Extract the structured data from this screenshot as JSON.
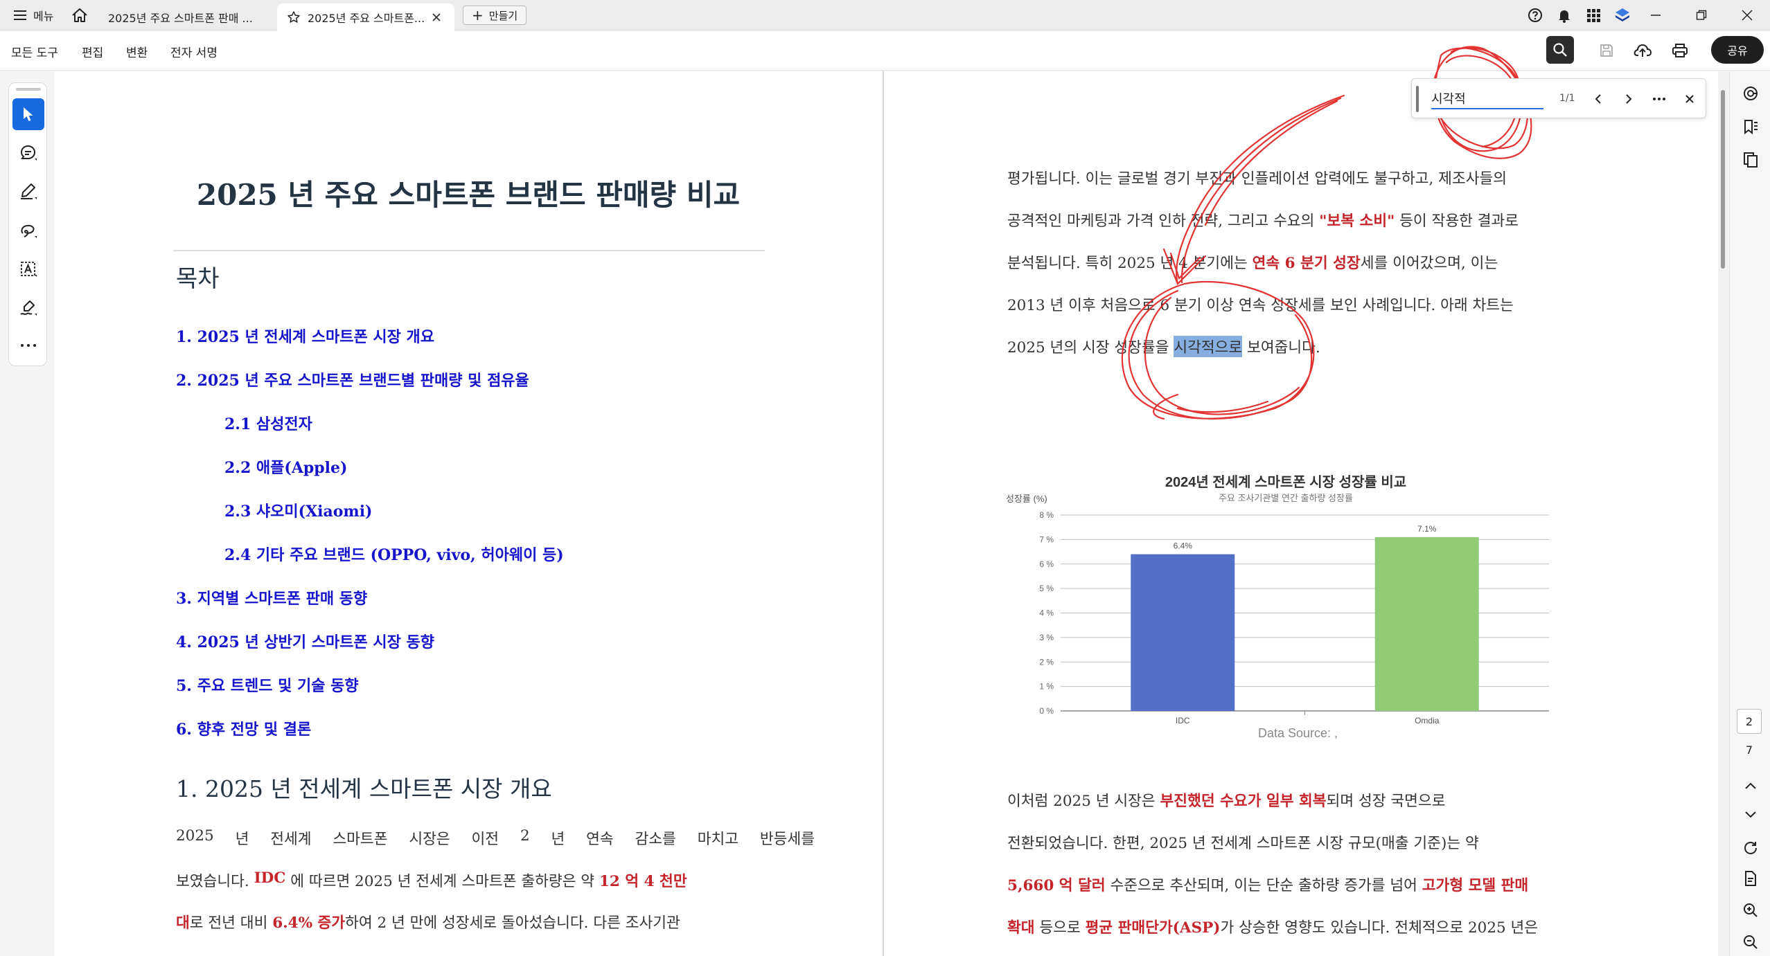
{
  "tabbar": {
    "menu_label": "메뉴",
    "tabs": [
      {
        "label": "2025년 주요 스마트폰 판매 ...",
        "active": false
      },
      {
        "label": "2025년 주요 스마트폰...",
        "active": true
      }
    ],
    "new_label": "만들기"
  },
  "toolbar": {
    "items": [
      "모든 도구",
      "편집",
      "변환",
      "전자 서명"
    ],
    "share_label": "공유"
  },
  "findbar": {
    "query": "시각적",
    "count": "1/1"
  },
  "left_page": {
    "title": "2025 년 주요 스마트폰 브랜드 판매량 비교",
    "toc_heading": "목차",
    "toc": [
      "1. 2025 년 전세계 스마트폰 시장 개요",
      "2. 2025 년 주요 스마트폰 브랜드별 판매량 및 점유율",
      "2.1 삼성전자",
      "2.2 애플(Apple)",
      "2.3 샤오미(Xiaomi)",
      "2.4 기타 주요 브랜드 (OPPO, vivo, 허아웨이 등)",
      "3. 지역별 스마트폰 판매 동향",
      "4. 2025 년 상반기 스마트폰 시장 동향",
      "5. 주요 트렌드 및 기술 동향",
      "6. 향후 전망 및 결론"
    ],
    "section1_heading": "1. 2025 년 전세계 스마트폰 시장 개요",
    "para": {
      "l1": [
        "2025",
        "년",
        "전세계",
        "스마트폰",
        "시장은",
        "이전",
        "2",
        "년",
        "연속",
        "감소를",
        "마치고",
        "반등세를"
      ],
      "l2_a": "보였습니다.",
      "l2_red1": "IDC",
      "l2_b": "에 따르면 2025 년 전세계 스마트폰 출하량은 약",
      "l2_red2": "12 억 4 천만",
      "l3_red1": "대",
      "l3_a": "로 전년 대비",
      "l3_red2": "6.4% 증가",
      "l3_b": "하여 2 년 만에 성장세로 돌아섰습니다. 다른 조사기관"
    }
  },
  "right_page": {
    "p1": {
      "l1": "평가됩니다. 이는 글로벌 경기 부진과 인플레이션 압력에도 불구하고, 제조사들의",
      "l2_a": "공격적인 마케팅과 가격 인하 전략, 그리고 수요의",
      "l2_red": "\"보복 소비\"",
      "l2_b": "등이 작용한 결과로",
      "l3_a": "분석됩니다. 특히 2025 년 4 분기에는",
      "l3_red": "연속 6 분기 성장",
      "l3_b": "세를 이어갔으며, 이는",
      "l4": "2013 년 이후 처음으로 6 분기 이상 연속 성장세를 보인 사례입니다. 아래 차트는",
      "l5_a": "2025 년의 시장 성장률을",
      "l5_hl": "시각적으로",
      "l5_b": "보여줍니다."
    },
    "data_source": "Data Source: ,",
    "p2": {
      "l1_a": "이처럼 2025 년 시장은",
      "l1_red": "부진했던 수요가 일부 회복",
      "l1_b": "되며 성장 국면으로",
      "l2": "전환되었습니다. 한편, 2025 년 전세계 스마트폰 시장 규모(매출 기준)는 약",
      "l3_red1": "5,660 억 달러",
      "l3_a": "수준으로 추산되며, 이는 단순 출하량 증가를 넘어",
      "l3_red2": "고가형 모델 판매",
      "l4_red1": "확대",
      "l4_a": "등으로",
      "l4_red2": "평균 판매단가(ASP)",
      "l4_b": "가 상승한 영향도 있습니다. 전체적으로 2025 년은"
    }
  },
  "chart_data": {
    "type": "bar",
    "title": "2024년 전세계 스마트폰 시장 성장률 비교",
    "subtitle": "주요 조사기관별 연간 출하량 성장률",
    "ylabel": "성장률 (%)",
    "xlabel": "",
    "categories": [
      "IDC",
      "Omdia"
    ],
    "values": [
      6.4,
      7.1
    ],
    "data_labels": [
      "6.4%",
      "7.1%"
    ],
    "ylim": [
      0,
      8
    ],
    "yticks": [
      "0 %",
      "1 %",
      "2 %",
      "3 %",
      "4 %",
      "5 %",
      "6 %",
      "7 %",
      "8 %"
    ],
    "colors": [
      "#5470c6",
      "#91cc75"
    ],
    "grid": true
  },
  "right_rail": {
    "current_page": "2",
    "total_pages": "7"
  },
  "colors": {
    "accent": "#1769e0",
    "red_text": "#c4242a",
    "toc_blue": "#1515cc",
    "highlight": "#86aee0",
    "scribble": "#e01e1e"
  }
}
